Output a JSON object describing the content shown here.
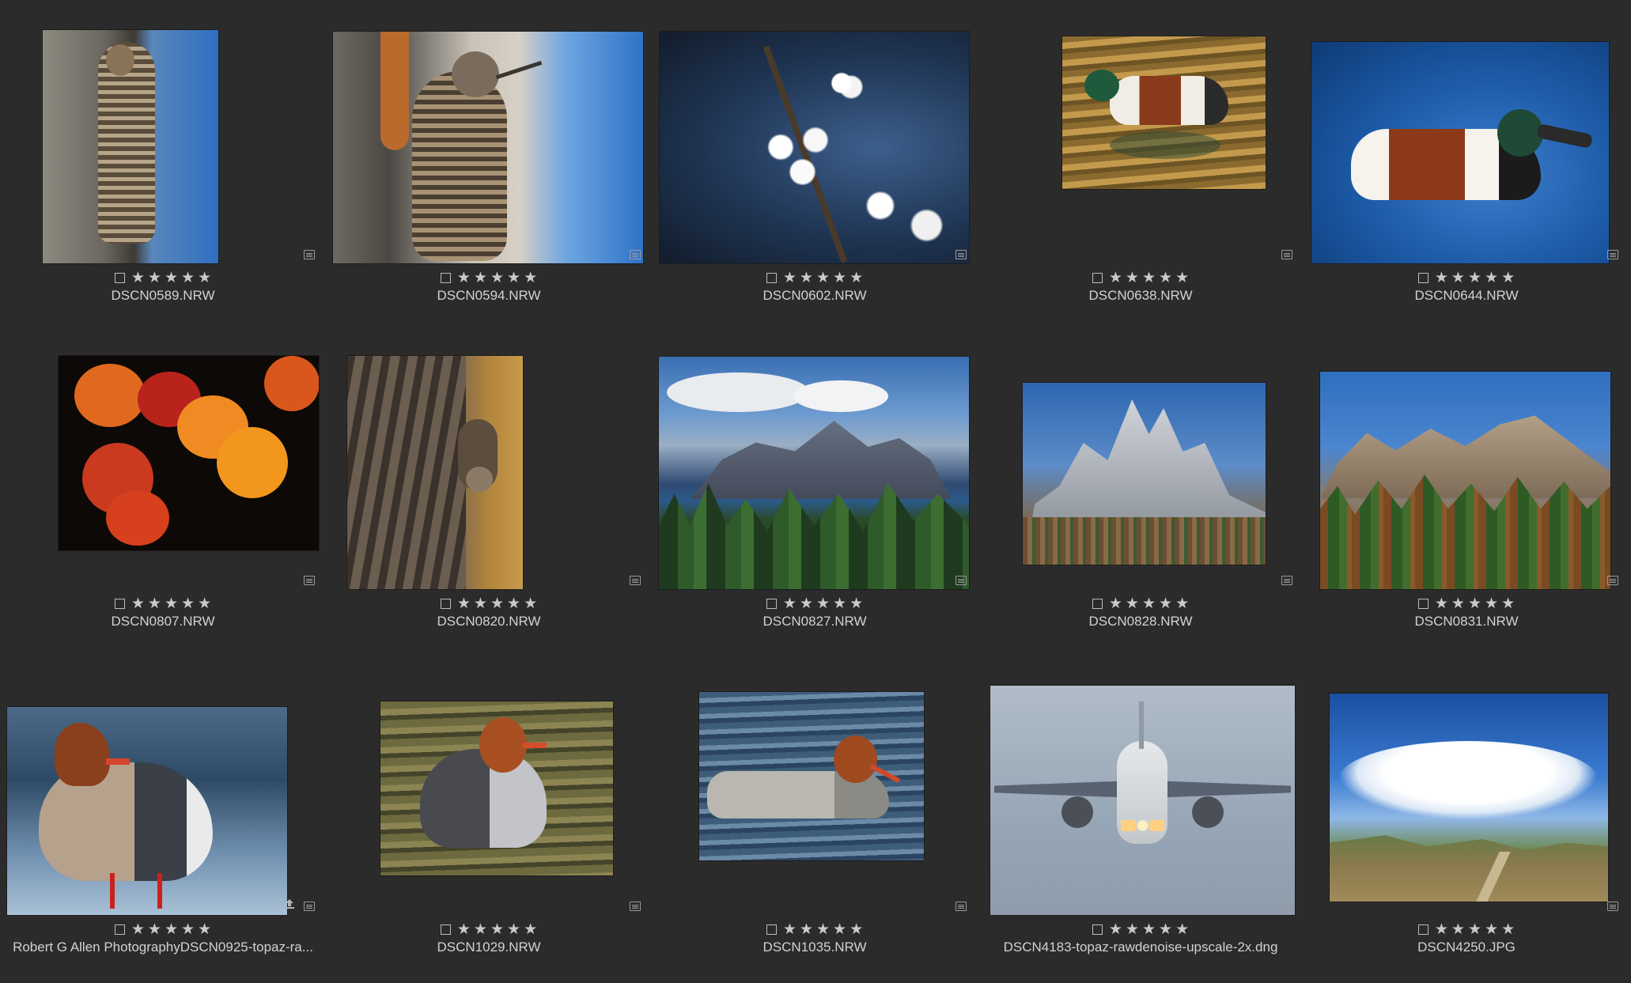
{
  "thumbnails": [
    {
      "filename": "DSCN0589.NRW",
      "rating": 0,
      "subject": "woodpecker-on-bark"
    },
    {
      "filename": "DSCN0594.NRW",
      "rating": 0,
      "subject": "woodpecker-with-branches"
    },
    {
      "filename": "DSCN0602.NRW",
      "rating": 0,
      "subject": "white-blossoms"
    },
    {
      "filename": "DSCN0638.NRW",
      "rating": 0,
      "subject": "shoveler-duck-gold-water"
    },
    {
      "filename": "DSCN0644.NRW",
      "rating": 0,
      "subject": "shoveler-duck-blue-water"
    },
    {
      "filename": "DSCN0807.NRW",
      "rating": 0,
      "subject": "autumn-aspen-leaves"
    },
    {
      "filename": "DSCN0820.NRW",
      "rating": 0,
      "subject": "squirrel-on-tree"
    },
    {
      "filename": "DSCN0827.NRW",
      "rating": 0,
      "subject": "mountain-lake-forest"
    },
    {
      "filename": "DSCN0828.NRW",
      "rating": 0,
      "subject": "granite-peak"
    },
    {
      "filename": "DSCN0831.NRW",
      "rating": 0,
      "subject": "mountain-forest"
    },
    {
      "filename": "Robert G Allen PhotographyDSCN0925-topaz-ra...",
      "rating": 0,
      "subject": "merganser-standing"
    },
    {
      "filename": "DSCN1029.NRW",
      "rating": 0,
      "subject": "merganser-in-stream"
    },
    {
      "filename": "DSCN1035.NRW",
      "rating": 0,
      "subject": "merganser-swimming"
    },
    {
      "filename": "DSCN4183-topaz-rawdenoise-upscale-2x.dng",
      "rating": 0,
      "subject": "airliner-landing"
    },
    {
      "filename": "DSCN4250.JPG",
      "rating": 0,
      "subject": "storm-cloud-meadow"
    }
  ],
  "icons": {
    "metadata": "metadata-badge-icon",
    "export": "export-badge-icon",
    "star": "★"
  },
  "colors": {
    "background": "#2b2b2b",
    "text": "#d2d2d2"
  }
}
